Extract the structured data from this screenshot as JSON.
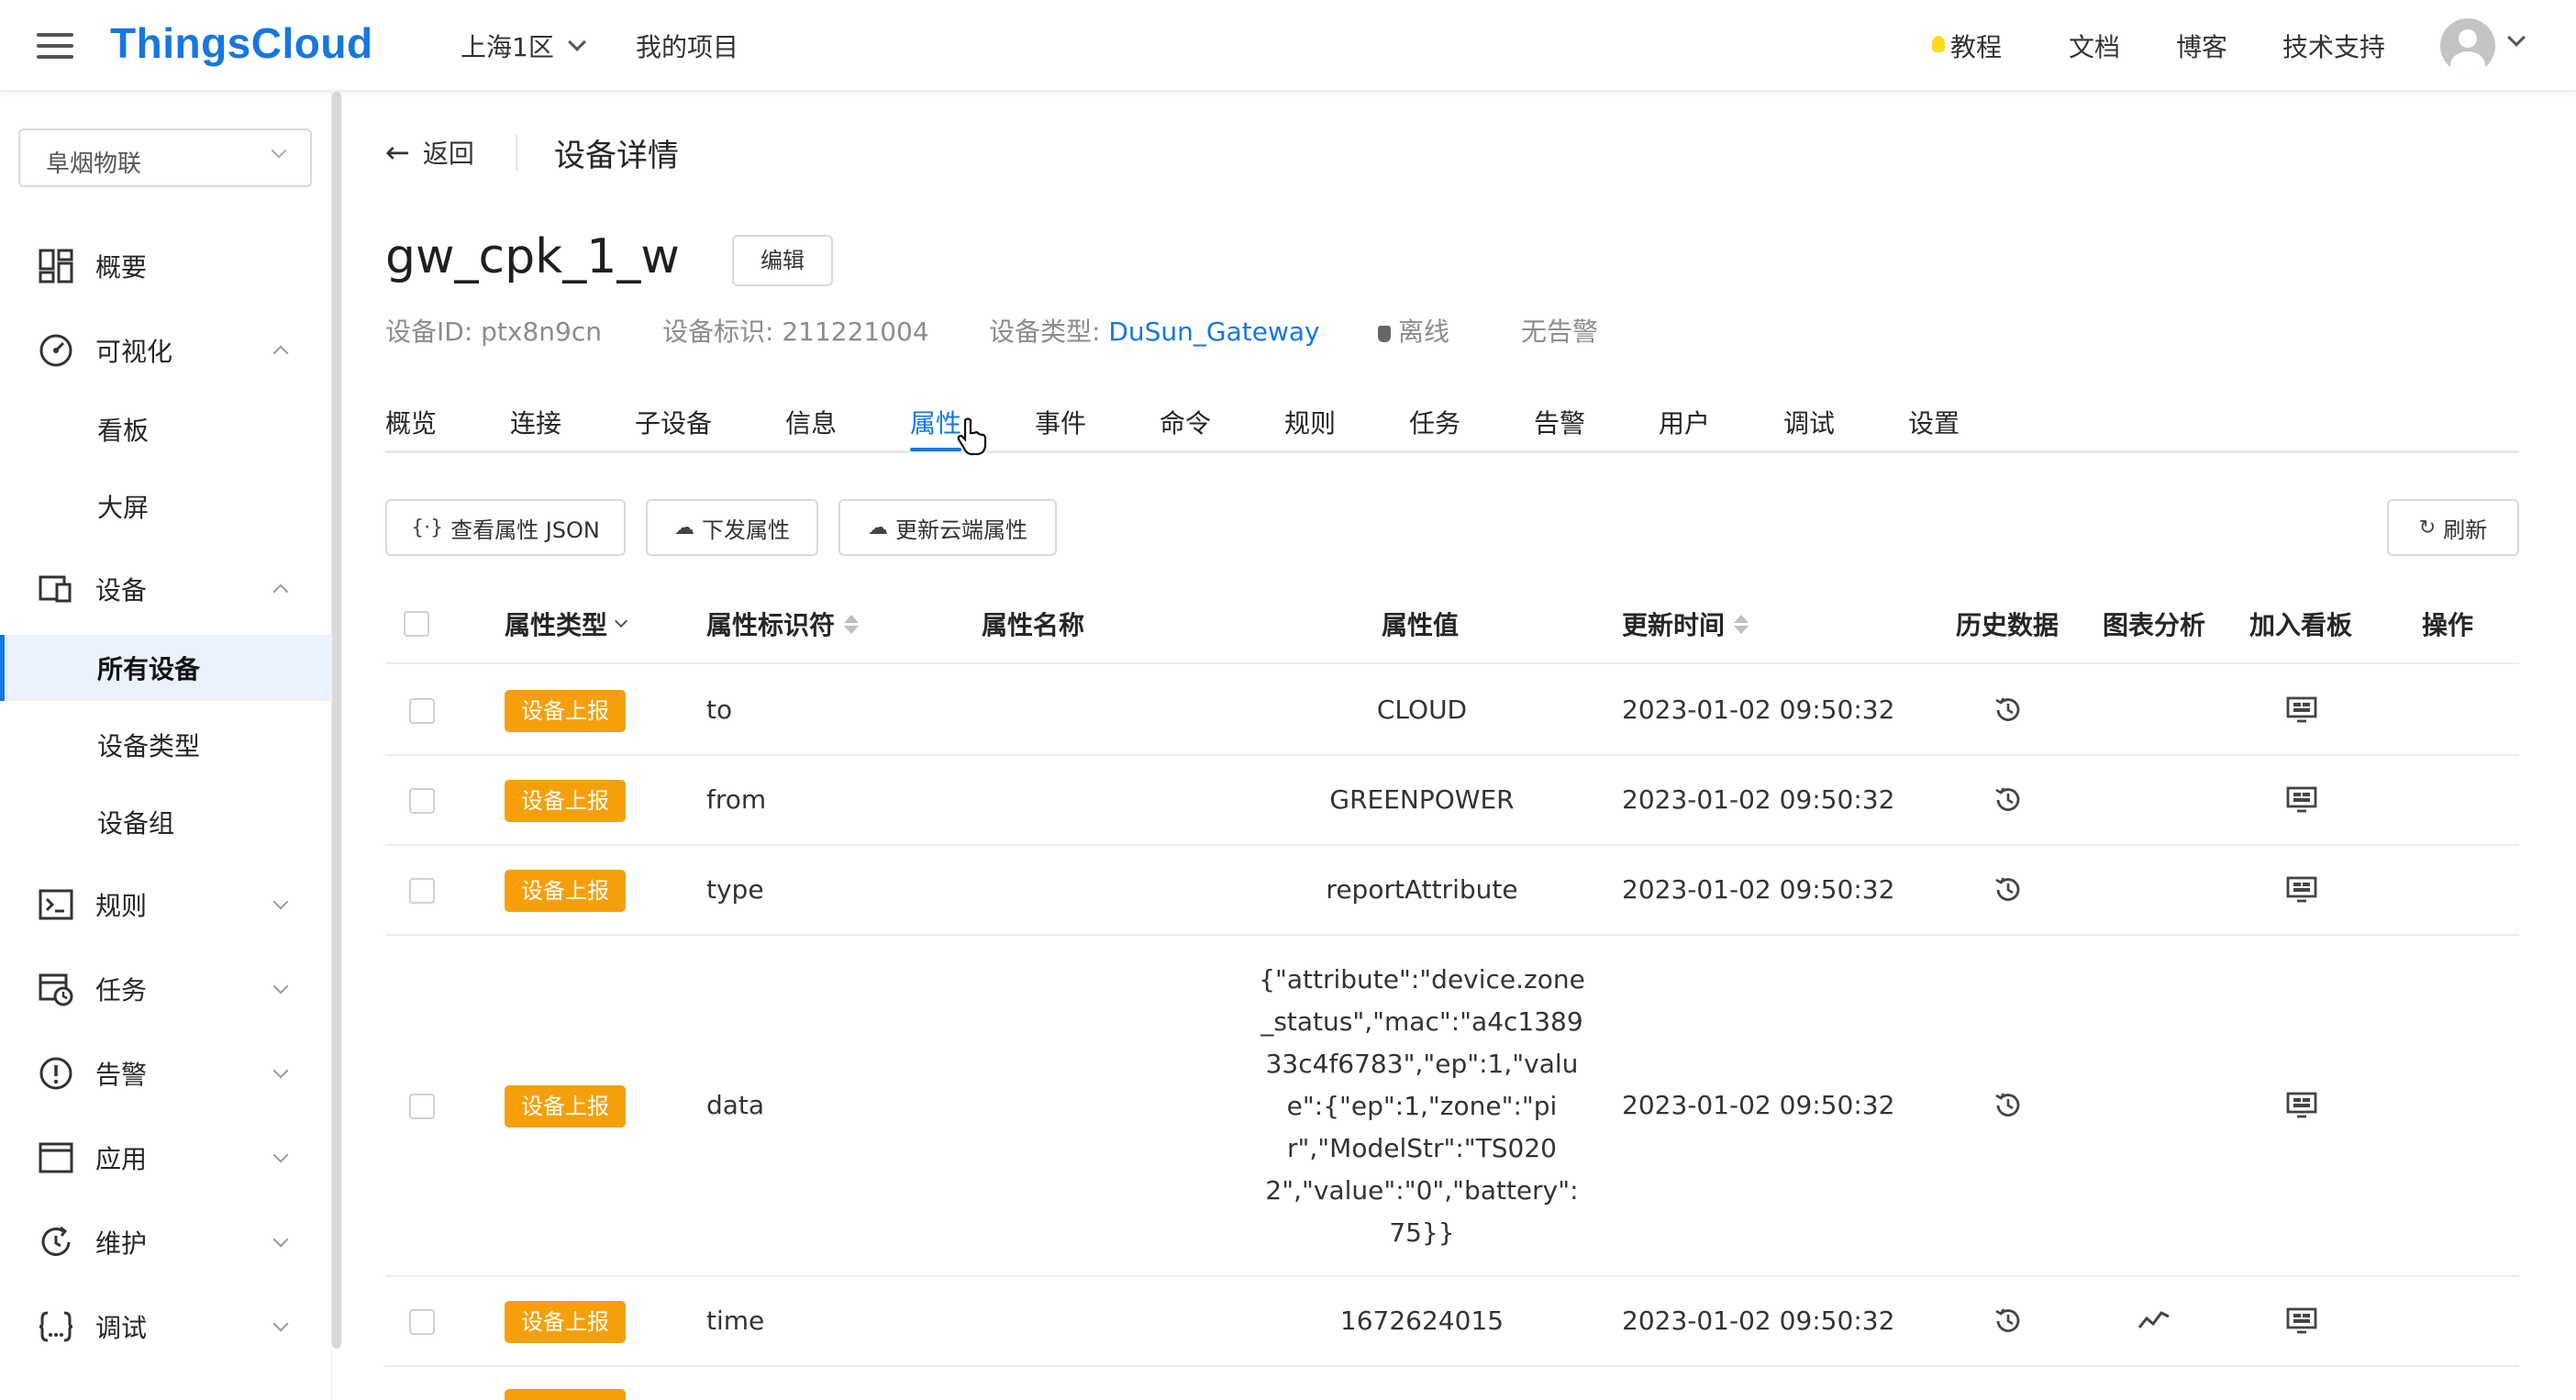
{
  "header": {
    "logo": "ThingsCloud",
    "region": "上海1区",
    "my_projects": "我的项目",
    "nav": [
      "教程",
      "文档",
      "博客",
      "技术支持"
    ]
  },
  "sidebar": {
    "project": "阜烟物联",
    "menu": {
      "overview": "概要",
      "visual": "可视化",
      "board": "看板",
      "screen": "大屏",
      "device": "设备",
      "all_devices": "所有设备",
      "device_types": "设备类型",
      "device_groups": "设备组",
      "rules": "规则",
      "tasks": "任务",
      "alarms": "告警",
      "apps": "应用",
      "maintain": "维护",
      "debug": "调试"
    }
  },
  "page": {
    "back": "返回",
    "title": "设备详情",
    "device_name": "gw_cpk_1_w",
    "edit": "编辑",
    "device_id": "设备ID: ptx8n9cn",
    "device_key": "设备标识: 211221004",
    "device_type_label": "设备类型: ",
    "device_type": "DuSun_Gateway",
    "status": "离线",
    "alarm": "无告警"
  },
  "tabs": [
    "概览",
    "连接",
    "子设备",
    "信息",
    "属性",
    "事件",
    "命令",
    "规则",
    "任务",
    "告警",
    "用户",
    "调试",
    "设置"
  ],
  "toolbar": {
    "view_json": "查看属性 JSON",
    "send": "下发属性",
    "update_cloud": "更新云端属性",
    "refresh": "刷新"
  },
  "table": {
    "columns": [
      "属性类型",
      "属性标识符",
      "属性名称",
      "属性值",
      "更新时间",
      "历史数据",
      "图表分析",
      "加入看板",
      "操作"
    ],
    "rows": [
      {
        "type": "设备上报",
        "id": "to",
        "name": "",
        "value": "CLOUD",
        "time": "2023-01-02 09:50:32",
        "chart": false
      },
      {
        "type": "设备上报",
        "id": "from",
        "name": "",
        "value": "GREENPOWER",
        "time": "2023-01-02 09:50:32",
        "chart": false
      },
      {
        "type": "设备上报",
        "id": "type",
        "name": "",
        "value": "reportAttribute",
        "time": "2023-01-02 09:50:32",
        "chart": false
      },
      {
        "type": "设备上报",
        "id": "data",
        "name": "",
        "value_lines": [
          "{\"attribute\":\"device.zone",
          "_status\",\"mac\":\"a4c1389",
          "33c4f6783\",\"ep\":1,\"valu",
          "e\":{\"ep\":1,\"zone\":\"pi",
          "r\",\"ModelStr\":\"TS020",
          "2\",\"value\":\"0\",\"battery\":",
          "75}}"
        ],
        "time": "2023-01-02 09:50:32",
        "chart": false
      },
      {
        "type": "设备上报",
        "id": "time",
        "name": "",
        "value": "1672624015",
        "time": "2023-01-02 09:50:32",
        "chart": true
      }
    ]
  },
  "colors": {
    "accent": "#1677e0",
    "tag": "#f5a00a"
  }
}
